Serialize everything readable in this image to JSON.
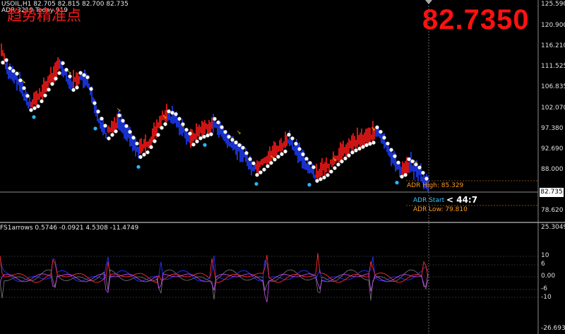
{
  "header": {
    "symbol_line": "USOIL,H1  82.705 82.815 82.700 82.735",
    "adr_line": "ADR 3219  Today 919",
    "indicator_title_cn": "趋势精准点"
  },
  "big_price": "82.7350",
  "price_axis": {
    "ticks": [
      "125.590",
      "120.900",
      "116.210",
      "111.525",
      "106.835",
      "102.070",
      "97.380",
      "92.690",
      "88.000",
      "78.620"
    ],
    "current_price_tag": "82.735"
  },
  "adr_panel": {
    "high": "ADR High: 85.329",
    "start": "ADR Start",
    "timer": "< 44:7",
    "low": "ADR Low: 79.810"
  },
  "indicator": {
    "label": "FS1arrows 0.5746 -0.0921 4.5308 -11.4749",
    "axis_ticks": [
      "25.3049",
      "10",
      "6",
      "0.00",
      "-6",
      "-10",
      "-26.6936"
    ]
  },
  "colors": {
    "background": "#000000",
    "bull": "#ff1a1a",
    "bear": "#1e3cff",
    "dots": "#ffffff",
    "signal_dot": "#29b6f6",
    "adr_text": "#ff9a1a",
    "big_price": "#ff1111"
  }
}
